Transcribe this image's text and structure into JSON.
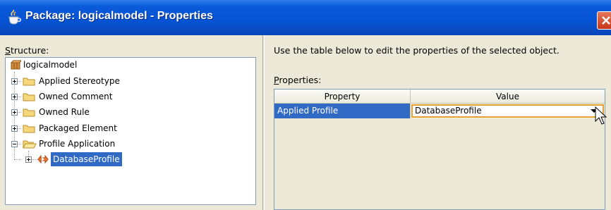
{
  "window": {
    "title": "Package: logicalmodel - Properties"
  },
  "structure": {
    "label_accel": "S",
    "label_rest": "tructure:",
    "root": "logicalmodel",
    "items": [
      {
        "label": "Applied Stereotype"
      },
      {
        "label": "Owned Comment"
      },
      {
        "label": "Owned Rule"
      },
      {
        "label": "Packaged Element"
      },
      {
        "label": "Profile Application"
      },
      {
        "label": "DatabaseProfile"
      }
    ]
  },
  "instructions": "Use the table below to edit the properties of the selected object.",
  "properties": {
    "label_accel": "P",
    "label_rest": "roperties:",
    "columns": [
      "Property",
      "Value"
    ],
    "rows": [
      {
        "property": "Applied Profile",
        "value": "DatabaseProfile"
      }
    ]
  },
  "colors": {
    "titlebar": "#0553d4",
    "selection": "#316ac5",
    "combo_border": "#e5a12f"
  }
}
